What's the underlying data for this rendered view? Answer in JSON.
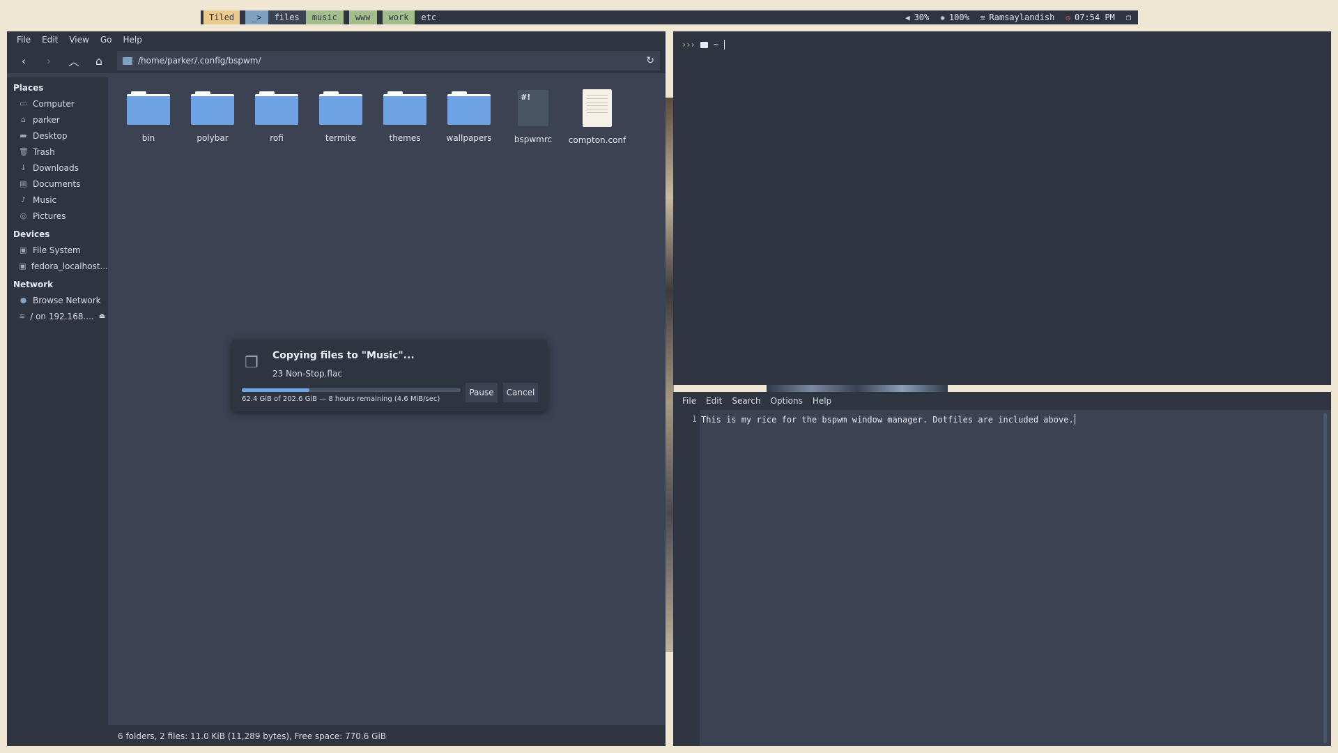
{
  "bar": {
    "mode": "Tiled",
    "workspaces": [
      "_>",
      "files",
      "music",
      "www",
      "work",
      "etc"
    ],
    "volume": "30%",
    "brightness": "100%",
    "wifi": "Ramsaylandish",
    "time": "07:54 PM"
  },
  "filemanager": {
    "menu": [
      "File",
      "Edit",
      "View",
      "Go",
      "Help"
    ],
    "path": "/home/parker/.config/bspwm/",
    "sidebar": {
      "places_heading": "Places",
      "places": [
        "Computer",
        "parker",
        "Desktop",
        "Trash",
        "Downloads",
        "Documents",
        "Music",
        "Pictures"
      ],
      "devices_heading": "Devices",
      "devices": [
        "File System",
        "fedora_localhost..."
      ],
      "network_heading": "Network",
      "network": [
        "Browse Network",
        "/ on 192.168...."
      ]
    },
    "files": [
      "bin",
      "polybar",
      "rofi",
      "termite",
      "themes",
      "wallpapers",
      "bspwmrc",
      "compton.conf"
    ],
    "script_glyph": "#!",
    "status": "6 folders, 2 files: 11.0 KiB (11,289 bytes), Free space: 770.6 GiB"
  },
  "dialog": {
    "title": "Copying files to \"Music\"...",
    "current_file": "23 Non-Stop.flac",
    "progress_fraction": 0.308,
    "detail": "62.4 GiB of 202.6 GiB — 8 hours remaining (4.6 MiB/sec)",
    "pause_label": "Pause",
    "cancel_label": "Cancel"
  },
  "terminal": {
    "prompt_arrows": "›››",
    "prompt_dir": "~"
  },
  "editor": {
    "menu": [
      "File",
      "Edit",
      "Search",
      "Options",
      "Help"
    ],
    "line_number": "1",
    "line_text": "This is my rice for the bspwm window manager. Dotfiles are included above."
  }
}
